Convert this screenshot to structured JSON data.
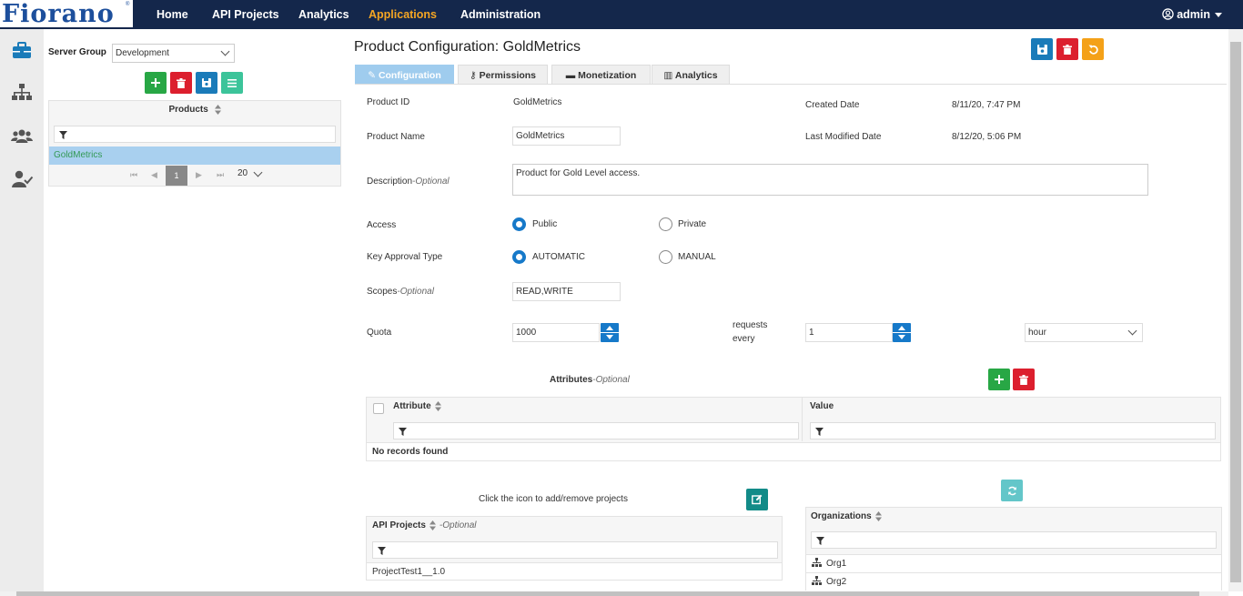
{
  "nav": {
    "logo": "Fiorano",
    "logo_mark": "®",
    "items": [
      {
        "label": "Home"
      },
      {
        "label": "API Projects"
      },
      {
        "label": "Analytics"
      },
      {
        "label": "Applications"
      },
      {
        "label": "Administration"
      }
    ],
    "active": "Applications",
    "user": "admin"
  },
  "rail": {
    "icons": [
      "briefcase-icon",
      "sitemap-icon",
      "users-icon",
      "user-check-icon"
    ]
  },
  "products_panel": {
    "server_group_label": "Server Group",
    "server_group_value": "Development",
    "header": "Products",
    "selected_item": "GoldMetrics",
    "current_page": "1",
    "page_size": "20"
  },
  "page": {
    "title": "Product Configuration: GoldMetrics",
    "tabs": [
      {
        "label": "Configuration",
        "icon": "pencil-icon"
      },
      {
        "label": "Permissions",
        "icon": "key-icon"
      },
      {
        "label": "Monetization",
        "icon": "card-icon"
      },
      {
        "label": "Analytics",
        "icon": "chart-icon"
      }
    ],
    "active_tab": "Configuration"
  },
  "form": {
    "product_id_label": "Product ID",
    "product_id_value": "GoldMetrics",
    "created_label": "Created Date",
    "created_value": "8/11/20, 7:47 PM",
    "product_name_label": "Product Name",
    "product_name_value": "GoldMetrics",
    "modified_label": "Last Modified Date",
    "modified_value": "8/12/20, 5:06 PM",
    "description_label": "Description",
    "description_optional": "-Optional",
    "description_value": "Product for Gold Level access.",
    "access_label": "Access",
    "access_options": [
      "Public",
      "Private"
    ],
    "access_selected": "Public",
    "key_approval_label": "Key Approval Type",
    "key_approval_options": [
      "AUTOMATIC",
      "MANUAL"
    ],
    "key_approval_selected": "AUTOMATIC",
    "scopes_label": "Scopes",
    "scopes_optional": "-Optional",
    "scopes_value": "READ,WRITE",
    "quota_label": "Quota",
    "quota_value": "1000",
    "requests_label_1": "requests",
    "requests_label_2": "every",
    "interval_value": "1",
    "unit_value": "hour"
  },
  "attributes": {
    "title": "Attributes",
    "optional": "-Optional",
    "col_attribute": "Attribute",
    "col_value": "Value",
    "empty": "No records found"
  },
  "projects": {
    "hint": "Click the icon to add/remove projects",
    "header": "API Projects",
    "optional": "-Optional",
    "rows": [
      "ProjectTest1__1.0"
    ]
  },
  "organizations": {
    "header": "Organizations",
    "rows": [
      "Org1",
      "Org2"
    ]
  },
  "colors": {
    "navbar": "#14274b",
    "active_nav": "#f5a623",
    "primary": "#1679c9",
    "add": "#28a745",
    "delete": "#dc1f2e",
    "undo": "#f4a118"
  }
}
